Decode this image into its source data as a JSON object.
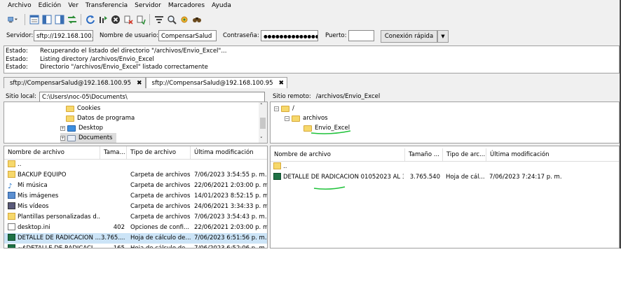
{
  "menu": [
    "Archivo",
    "Edición",
    "Ver",
    "Transferencia",
    "Servidor",
    "Marcadores",
    "Ayuda"
  ],
  "toolbar_icons": [
    "site-manager-icon",
    "toggle-log-icon",
    "toggle-local-tree-icon",
    "toggle-remote-tree-icon",
    "transfer-queue-icon",
    "refresh-icon",
    "process-queue-icon",
    "cancel-icon",
    "disconnect-icon",
    "reconnect-icon",
    "filter-icon",
    "compare-icon",
    "sync-browse-icon",
    "search-icon"
  ],
  "quickconnect": {
    "server_label": "Servidor:",
    "server_value": "sftp://192.168.100.9",
    "user_label": "Nombre de usuario:",
    "user_value": "CompensarSalud",
    "password_label": "Contraseña:",
    "password_value": "●●●●●●●●●●●●●●●",
    "port_label": "Puerto:",
    "port_value": "",
    "connect_button": "Conexión rápida"
  },
  "log": [
    {
      "status": "Estado:",
      "msg": "Recuperando el listado del directorio \"/archivos/Envio_Excel\"..."
    },
    {
      "status": "Estado:",
      "msg": "Listing directory /archivos/Envio_Excel"
    },
    {
      "status": "Estado:",
      "msg": "Directorio \"/archivos/Envio_Excel\" listado correctamente"
    }
  ],
  "tabs": [
    {
      "label": "sftp://CompensarSalud@192.168.100.95",
      "close": "✖"
    },
    {
      "label": "sftp://CompensarSalud@192.168.100.95",
      "close": "✖"
    }
  ],
  "local": {
    "site_label": "Sitio local:",
    "site_path": "C:\\Users\\noc-05\\Documents\\",
    "tree": [
      "Cookies",
      "Datos de programa",
      "Desktop",
      "Documents"
    ],
    "headers": [
      "Nombre de archivo",
      "Tama...",
      "Tipo de archivo",
      "Última modificación"
    ],
    "files": [
      {
        "name": "..",
        "size": "",
        "type": "",
        "modified": "",
        "icon": "folder"
      },
      {
        "name": "BACKUP EQUIPO",
        "size": "",
        "type": "Carpeta de archivos",
        "modified": "7/06/2023 3:54:55 p. m.",
        "icon": "folder"
      },
      {
        "name": "Mi música",
        "size": "",
        "type": "Carpeta de archivos",
        "modified": "22/06/2021 2:03:00 p. m.",
        "icon": "music"
      },
      {
        "name": "Mis imágenes",
        "size": "",
        "type": "Carpeta de archivos",
        "modified": "14/01/2023 8:52:15 p. m.",
        "icon": "pics"
      },
      {
        "name": "Mis vídeos",
        "size": "",
        "type": "Carpeta de archivos",
        "modified": "24/06/2021 3:34:33 p. m.",
        "icon": "video"
      },
      {
        "name": "Plantillas personalizadas d...",
        "size": "",
        "type": "Carpeta de archivos",
        "modified": "7/06/2023 3:54:43 p. m.",
        "icon": "folder"
      },
      {
        "name": "desktop.ini",
        "size": "402",
        "type": "Opciones de confi...",
        "modified": "22/06/2021 2:03:00 p. m.",
        "icon": "ini"
      },
      {
        "name": "DETALLE DE RADICACION ...",
        "size": "3.765....",
        "type": "Hoja de cálculo de...",
        "modified": "7/06/2023 6:51:56 p. m.",
        "icon": "xls"
      },
      {
        "name": "~$DETALLE DE RADICACI...",
        "size": "165",
        "type": "Hoja de cálculo de...",
        "modified": "7/06/2023 6:52:06 p. m.",
        "icon": "xls"
      }
    ]
  },
  "remote": {
    "site_label": "Sitio remoto:",
    "site_path": "/archivos/Envio_Excel",
    "tree": [
      "/",
      "archivos",
      "Envio_Excel"
    ],
    "headers": [
      "Nombre de archivo",
      "Tamaño ...",
      "Tipo de arc...",
      "Última modificación"
    ],
    "files": [
      {
        "name": "..",
        "size": "",
        "type": "",
        "modified": "",
        "icon": "folder"
      },
      {
        "name": "DETALLE DE RADICACION 01052023 AL 3...",
        "size": "3.765.540",
        "type": "Hoja de cál...",
        "modified": "7/06/2023 7:24:17 p. m.",
        "icon": "xls"
      }
    ]
  },
  "colors": {
    "annotation": "#1fc23a",
    "selection": "#cce4f7",
    "folder": "#f6d86b",
    "excel": "#1e7145"
  }
}
